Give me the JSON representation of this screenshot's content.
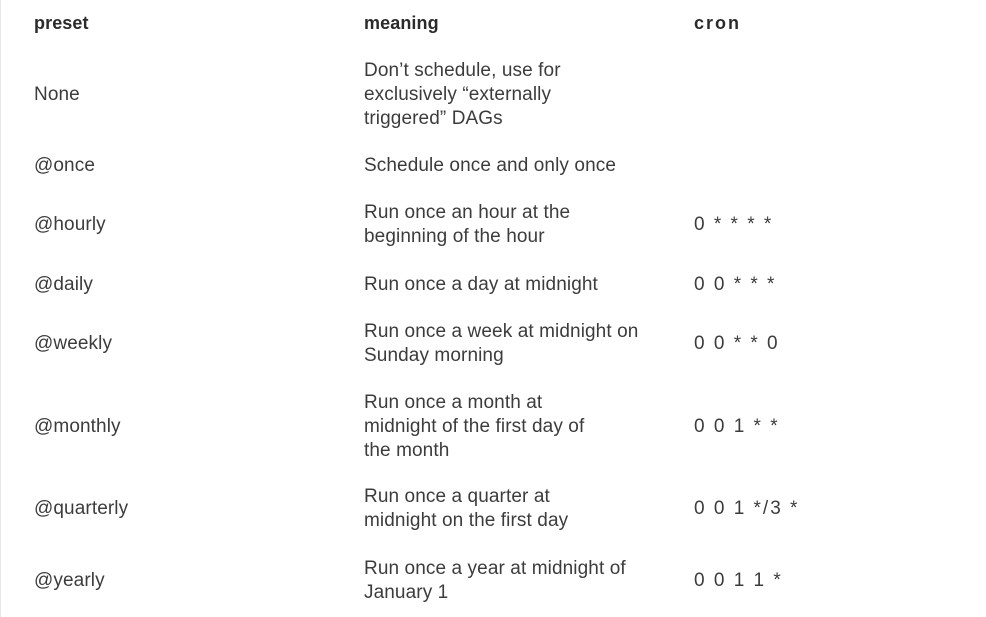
{
  "table": {
    "headers": {
      "preset": "preset",
      "meaning": "meaning",
      "cron": "cron"
    },
    "rows": [
      {
        "preset": "None",
        "meaning": "Don’t schedule, use for exclusively “externally triggered” DAGs",
        "cron": ""
      },
      {
        "preset": "@once",
        "meaning": "Schedule once and only once",
        "cron": ""
      },
      {
        "preset": "@hourly",
        "meaning": "Run once an hour at the beginning of the hour",
        "cron": "0 * * * *"
      },
      {
        "preset": "@daily",
        "meaning": "Run once a day at midnight",
        "cron": "0 0 * * *"
      },
      {
        "preset": "@weekly",
        "meaning": "Run once a week at midnight on Sunday morning",
        "cron": "0 0 * * 0"
      },
      {
        "preset": "@monthly",
        "meaning": "Run once a month at midnight of the first day of the month",
        "cron": "0 0 1 * *"
      },
      {
        "preset": "@quarterly",
        "meaning": "Run once a quarter at midnight on the first day",
        "cron": "0 0 1 */3 *"
      },
      {
        "preset": "@yearly",
        "meaning": "Run once a year at midnight of January 1",
        "cron": "0 0 1 1 *"
      }
    ]
  }
}
